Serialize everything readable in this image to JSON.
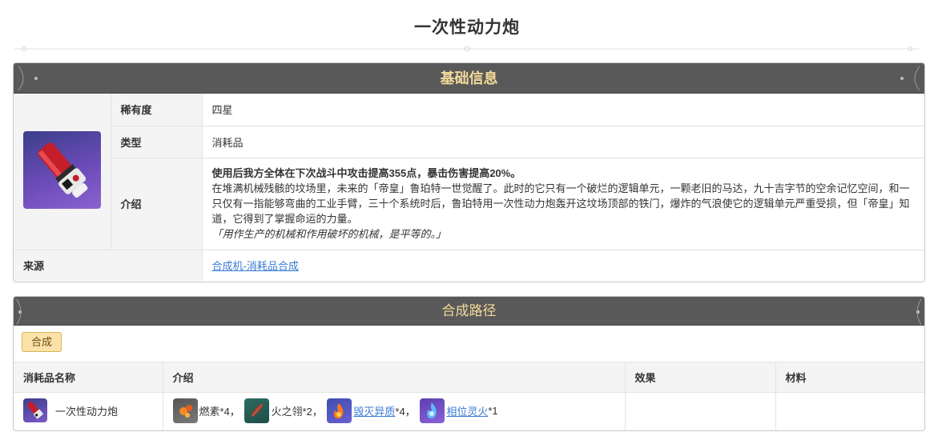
{
  "page": {
    "title": "一次性动力炮"
  },
  "basic_info": {
    "header": "基础信息",
    "rarity_label": "稀有度",
    "rarity_value": "四星",
    "type_label": "类型",
    "type_value": "消耗品",
    "intro_label": "介绍",
    "intro_effect": "使用后我方全体在下次战斗中攻击提高355点，暴击伤害提高20%。",
    "intro_story": "在堆满机械残骸的坟场里，未来的「帝皇」鲁珀特一世觉醒了。此时的它只有一个破烂的逻辑单元，一颗老旧的马达，九十吉字节的空余记忆空间，和一只仅有一指能够弯曲的工业手臂，三十个系统时后，鲁珀特用一次性动力炮轰开这坟场顶部的铁门，爆炸的气浪使它的逻辑单元严重受损，但「帝皇」知道，它得到了掌握命运的力量。",
    "intro_quote": "「用作生产的机械和作用破坏的机械，是平等的。」",
    "source_label": "来源",
    "source_value": "合成机-消耗品合成"
  },
  "recipe": {
    "header": "合成路径",
    "tag": "合成",
    "columns": [
      "消耗品名称",
      "介绍",
      "效果",
      "材料"
    ],
    "row": {
      "product_name": "一次性动力炮",
      "materials": [
        {
          "name": "燃素",
          "qty": "*4，",
          "is_link": false,
          "icon": "phlogiston-icon"
        },
        {
          "name": "火之翎",
          "qty": "*2，",
          "is_link": false,
          "icon": "fire-feather-icon"
        },
        {
          "name": "毁灭异质",
          "qty": "*4，",
          "is_link": true,
          "icon": "destruction-matter-icon"
        },
        {
          "name": "相位灵火",
          "qty": "*1",
          "is_link": true,
          "icon": "phase-flame-icon"
        }
      ],
      "effect": "",
      "material_col": ""
    }
  }
}
